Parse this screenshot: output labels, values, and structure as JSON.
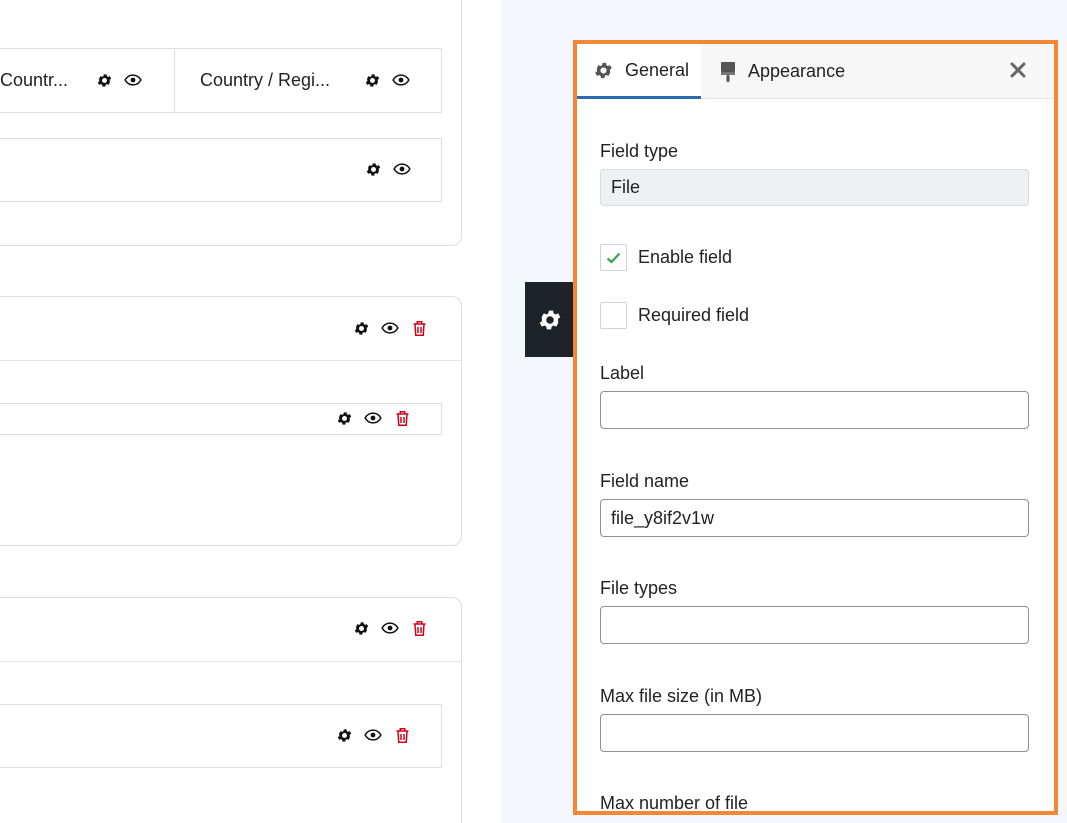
{
  "canvas": {
    "card1": {
      "field_a": {
        "label": "Countr..."
      },
      "field_b": {
        "label": "Country / Regi..."
      }
    }
  },
  "panel": {
    "tabs": [
      {
        "label": "General",
        "icon": "gear-icon",
        "active": true
      },
      {
        "label": "Appearance",
        "icon": "paint-brush-icon",
        "active": false
      }
    ],
    "form": {
      "field_type": {
        "label": "Field type",
        "value": "File"
      },
      "enable_field": {
        "label": "Enable field",
        "checked": true
      },
      "required_field": {
        "label": "Required field",
        "checked": false
      },
      "label": {
        "label": "Label",
        "value": ""
      },
      "field_name": {
        "label": "Field name",
        "value": "file_y8if2v1w"
      },
      "file_types": {
        "label": "File types",
        "value": ""
      },
      "max_file_size": {
        "label": "Max file size (in MB)",
        "value": ""
      },
      "max_number_of_file": {
        "label": "Max number of file"
      }
    }
  },
  "colors": {
    "panel_border": "#f58634",
    "active_tab_underline": "#2b6bb0",
    "delete_icon": "#d0021b",
    "check_mark": "#3aa655",
    "toggle_bg": "#1e2327"
  }
}
